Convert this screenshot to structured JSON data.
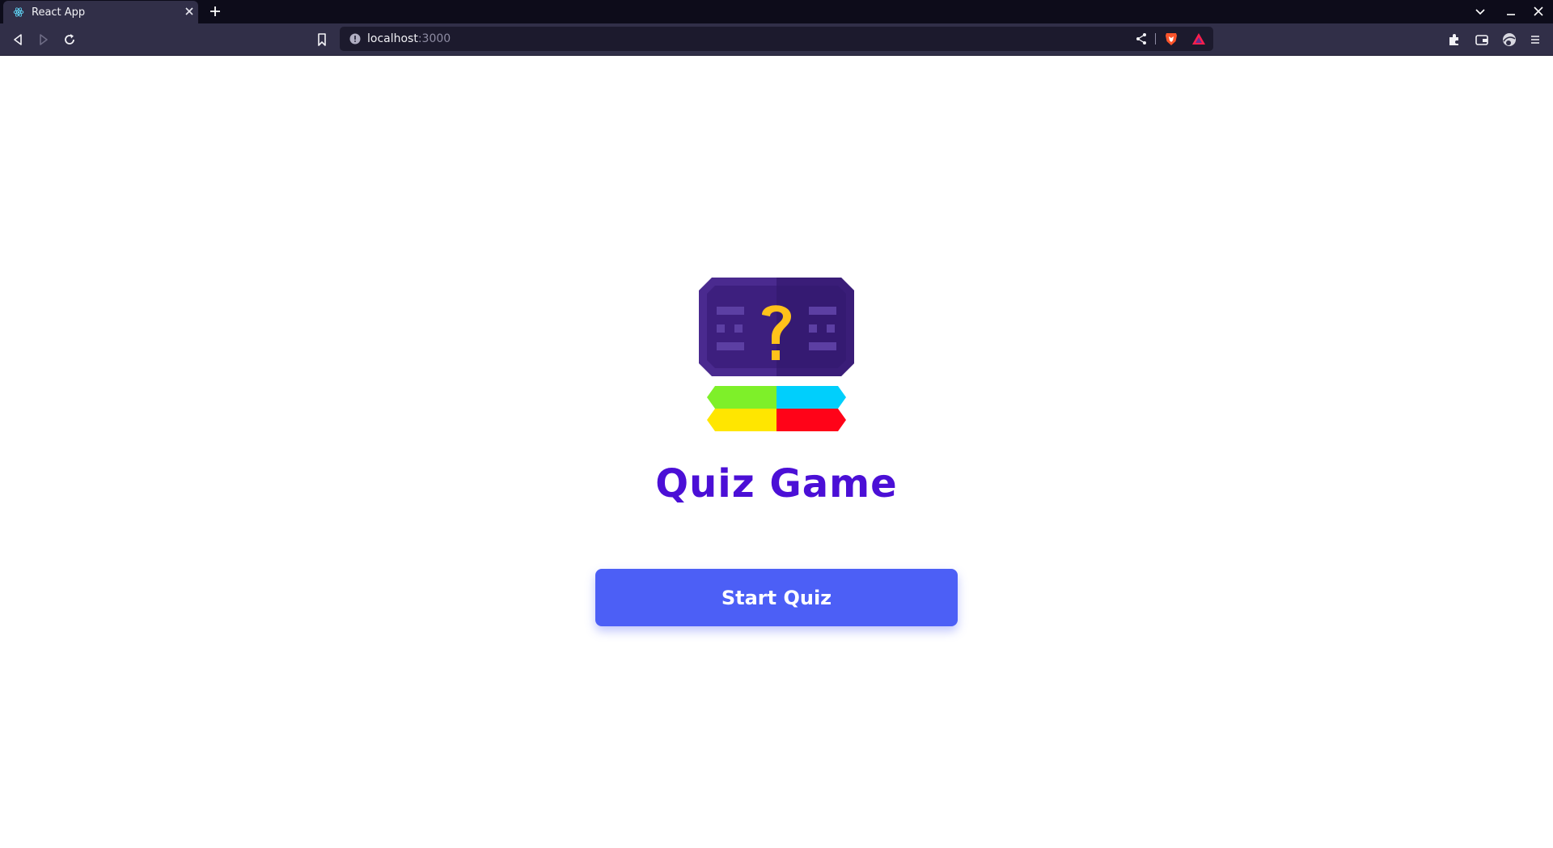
{
  "browser": {
    "tab": {
      "title": "React App",
      "favicon": "react-icon",
      "close_icon": "close-icon"
    },
    "new_tab_icon": "plus-icon",
    "window_controls": [
      "chevron-down-icon",
      "minimize-icon",
      "close-icon"
    ],
    "nav": [
      "back-icon",
      "forward-icon",
      "reload-icon"
    ],
    "bookmark_icon": "bookmark-icon",
    "url": {
      "host": "localhost",
      "port": ":3000",
      "info_icon": "info-icon"
    },
    "url_actions": [
      "share-icon",
      "brave-shields-icon",
      "brave-rewards-icon"
    ],
    "toolbar_actions": [
      "extensions-icon",
      "wallet-icon",
      "vpn-icon",
      "menu-icon"
    ]
  },
  "app": {
    "logo_icon": "quiz-logo-icon",
    "title": "Quiz Game",
    "start_button_label": "Start Quiz",
    "colors": {
      "title": "#4b0fd6",
      "button": "#4c5ff6",
      "logo_dark": "#3a1d78",
      "logo_mid": "#4a2a8f",
      "question_mark": "#ffc21a",
      "green": "#7ef029",
      "cyan": "#00cffc",
      "yellow": "#ffe600",
      "red": "#ff0318"
    }
  }
}
